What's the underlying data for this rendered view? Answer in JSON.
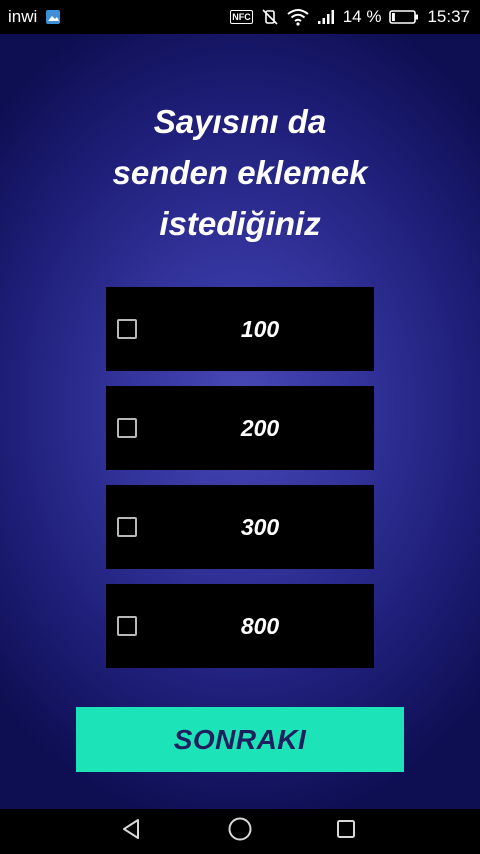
{
  "status_bar": {
    "carrier": "inwi",
    "battery_percent": "14 %",
    "battery_level": 0.14,
    "time": "15:37",
    "nfc_label": "NFC",
    "icons": [
      "gallery-notification-icon",
      "nfc-icon",
      "vibrate-off-icon",
      "wifi-icon",
      "signal-icon",
      "battery-icon"
    ]
  },
  "question": {
    "lines": [
      "Sayısını da",
      "senden eklemek",
      "istediğiniz"
    ]
  },
  "options": [
    {
      "label": "100",
      "checked": false
    },
    {
      "label": "200",
      "checked": false
    },
    {
      "label": "300",
      "checked": false
    },
    {
      "label": "800",
      "checked": false
    }
  ],
  "next_button": {
    "label": "SONRAKI"
  },
  "nav_bar": {
    "icons": [
      "back-icon",
      "home-icon",
      "recents-icon"
    ]
  },
  "colors": {
    "background_center": "#4848b8",
    "background_edge": "#0e0e52",
    "option_background": "#000000",
    "button_accent": "#1ce3b8",
    "button_text": "#1d1f5e"
  }
}
